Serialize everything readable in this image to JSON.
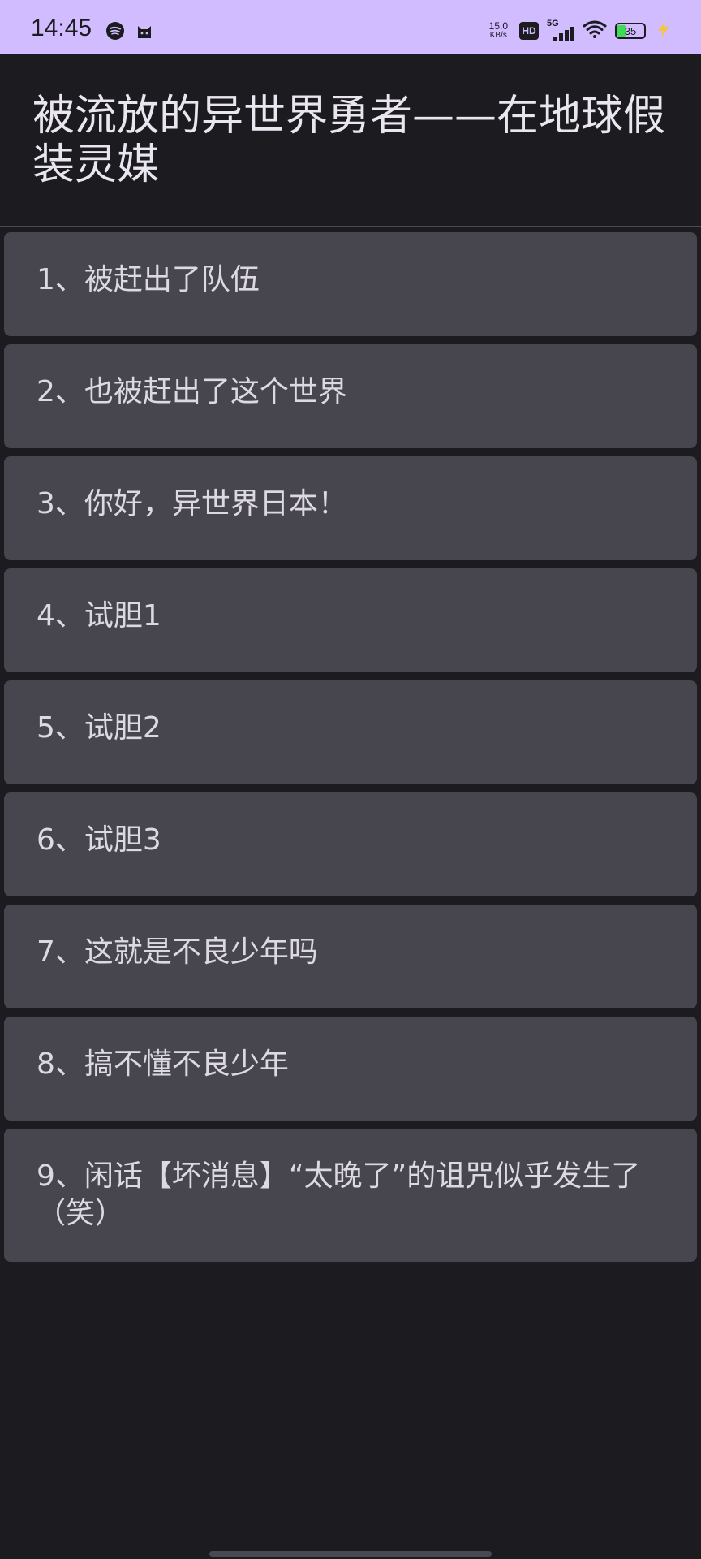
{
  "status_bar": {
    "time": "14:45",
    "net_speed_value": "15.0",
    "net_speed_unit": "KB/s",
    "hd_label": "HD",
    "network_type": "5G",
    "battery_level": "35",
    "icons": [
      "spotify-icon",
      "cat-icon",
      "hd-icon",
      "signal-icon",
      "wifi-icon",
      "battery-icon",
      "charging-icon"
    ]
  },
  "header": {
    "title": "被流放的异世界勇者——在地球假装灵媒"
  },
  "chapters": [
    {
      "label": "1、被赶出了队伍"
    },
    {
      "label": "2、也被赶出了这个世界"
    },
    {
      "label": "3、你好，异世界日本！"
    },
    {
      "label": "4、试胆1"
    },
    {
      "label": "5、试胆2"
    },
    {
      "label": "6、试胆3"
    },
    {
      "label": "7、这就是不良少年吗"
    },
    {
      "label": "8、搞不懂不良少年"
    },
    {
      "label": "9、闲话【坏消息】“太晚了”的诅咒似乎发生了（笑）"
    }
  ],
  "colors": {
    "status_bar_bg": "#d0bcff",
    "background": "#1c1b20",
    "card_bg": "#47454e",
    "text": "#ddd9e2"
  }
}
